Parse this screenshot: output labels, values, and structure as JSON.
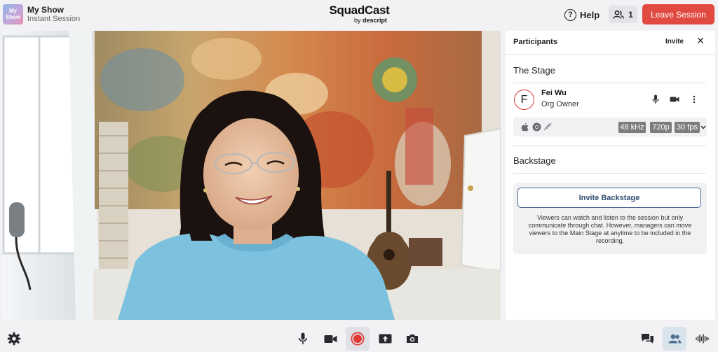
{
  "header": {
    "show_thumb": "My Show",
    "show_title": "My Show",
    "show_subtitle": "Instant Session",
    "logo_main": "SquadCast",
    "logo_by": "by",
    "logo_brand": "descript",
    "help_label": "Help",
    "help_glyph": "?",
    "participant_count": "1",
    "leave_label": "Leave Session"
  },
  "panel": {
    "title": "Participants",
    "invite_label": "Invite",
    "close_glyph": "✕",
    "stage_title": "The Stage",
    "participant": {
      "initial": "F",
      "name": "Fei Wu",
      "role": "Org Owner",
      "badges": [
        "48 kHz",
        "720p",
        "30 fps"
      ]
    },
    "backstage_title": "Backstage",
    "invite_backstage_label": "Invite Backstage",
    "backstage_text": "Viewers can watch and listen to the session but only communicate through chat. However, managers can move viewers to the Main Stage at anytime to be included in the recording."
  },
  "colors": {
    "leave_button": "#e14a41",
    "record_red": "#e23b36",
    "invite_border": "#4a6a94",
    "badge_bg": "#7d7d80"
  },
  "toolbar": {
    "left": [
      "settings-icon"
    ],
    "center": [
      "microphone-icon",
      "camera-icon",
      "record-icon",
      "share-upload-icon",
      "snapshot-icon"
    ],
    "right": [
      "chat-icon",
      "participants-icon",
      "audio-levels-icon"
    ]
  }
}
